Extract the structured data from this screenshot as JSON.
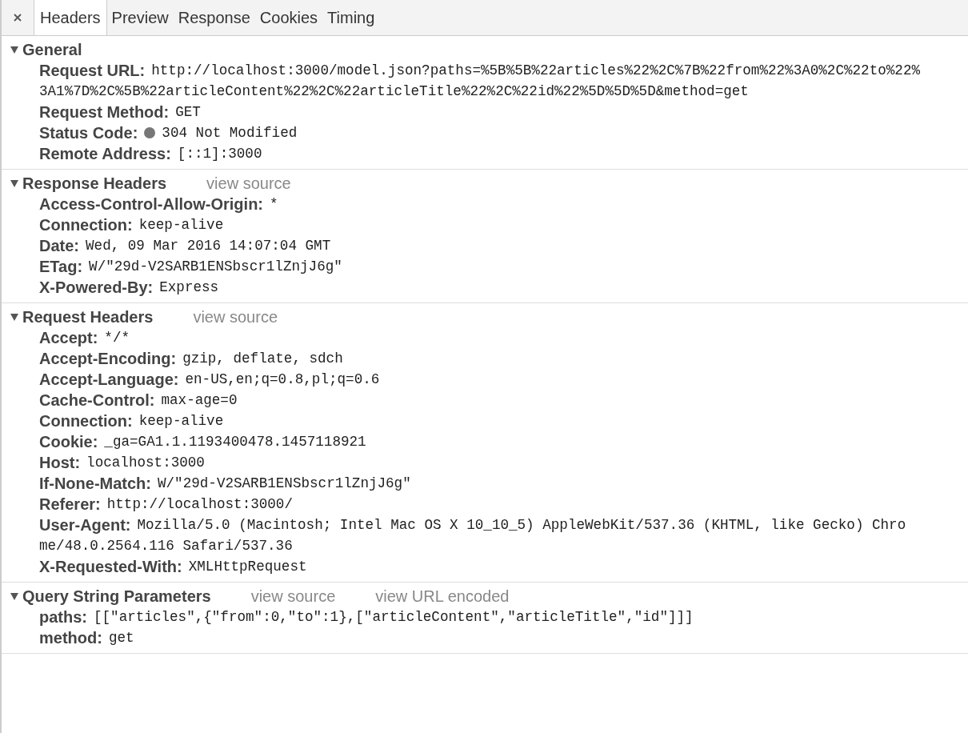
{
  "tabs": [
    {
      "label": "Headers",
      "selected": true
    },
    {
      "label": "Preview",
      "selected": false
    },
    {
      "label": "Response",
      "selected": false
    },
    {
      "label": "Cookies",
      "selected": false
    },
    {
      "label": "Timing",
      "selected": false
    }
  ],
  "sections": [
    {
      "title": "General",
      "expanded": true,
      "rows": [
        {
          "name": "Request URL:",
          "value": [
            "http://localhost:3000/model.json?paths=%5B%5B%22articles%22%2C%7B%22from%22%3A0%2C%22to%22%",
            "3A1%7D%2C%5B%22articleContent%22%2C%22articleTitle%22%2C%22id%22%5D%5D%5D&method=get"
          ]
        },
        {
          "name": "Request Method:",
          "value": [
            "GET"
          ]
        },
        {
          "name": "Status Code:",
          "status_dot": true,
          "value": [
            "304 Not Modified"
          ]
        },
        {
          "name": "Remote Address:",
          "value": [
            "[::1]:3000"
          ]
        }
      ]
    },
    {
      "title": "Response Headers",
      "expanded": true,
      "links": [
        "view source"
      ],
      "rows": [
        {
          "name": "Access-Control-Allow-Origin:",
          "value": [
            "*"
          ]
        },
        {
          "name": "Connection:",
          "value": [
            "keep-alive"
          ]
        },
        {
          "name": "Date:",
          "value": [
            "Wed, 09 Mar 2016 14:07:04 GMT"
          ]
        },
        {
          "name": "ETag:",
          "value": [
            "W/\"29d-V2SARB1ENSbscr1lZnjJ6g\""
          ]
        },
        {
          "name": "X-Powered-By:",
          "value": [
            "Express"
          ]
        }
      ]
    },
    {
      "title": "Request Headers",
      "expanded": true,
      "links": [
        "view source"
      ],
      "rows": [
        {
          "name": "Accept:",
          "value": [
            "*/*"
          ]
        },
        {
          "name": "Accept-Encoding:",
          "value": [
            "gzip, deflate, sdch"
          ]
        },
        {
          "name": "Accept-Language:",
          "value": [
            "en-US,en;q=0.8,pl;q=0.6"
          ]
        },
        {
          "name": "Cache-Control:",
          "value": [
            "max-age=0"
          ]
        },
        {
          "name": "Connection:",
          "value": [
            "keep-alive"
          ]
        },
        {
          "name": "Cookie:",
          "value": [
            "_ga=GA1.1.1193400478.1457118921"
          ]
        },
        {
          "name": "Host:",
          "value": [
            "localhost:3000"
          ]
        },
        {
          "name": "If-None-Match:",
          "value": [
            "W/\"29d-V2SARB1ENSbscr1lZnjJ6g\""
          ]
        },
        {
          "name": "Referer:",
          "value": [
            "http://localhost:3000/"
          ]
        },
        {
          "name": "User-Agent:",
          "value": [
            "Mozilla/5.0 (Macintosh; Intel Mac OS X 10_10_5) AppleWebKit/537.36 (KHTML, like Gecko) Chro",
            "me/48.0.2564.116 Safari/537.36"
          ]
        },
        {
          "name": "X-Requested-With:",
          "value": [
            "XMLHttpRequest"
          ]
        }
      ]
    },
    {
      "title": "Query String Parameters",
      "expanded": true,
      "links": [
        "view source",
        "view URL encoded"
      ],
      "rows": [
        {
          "name": "paths:",
          "value": [
            "[[\"articles\",{\"from\":0,\"to\":1},[\"articleContent\",\"articleTitle\",\"id\"]]]"
          ]
        },
        {
          "name": "method:",
          "value": [
            "get"
          ]
        }
      ]
    }
  ]
}
